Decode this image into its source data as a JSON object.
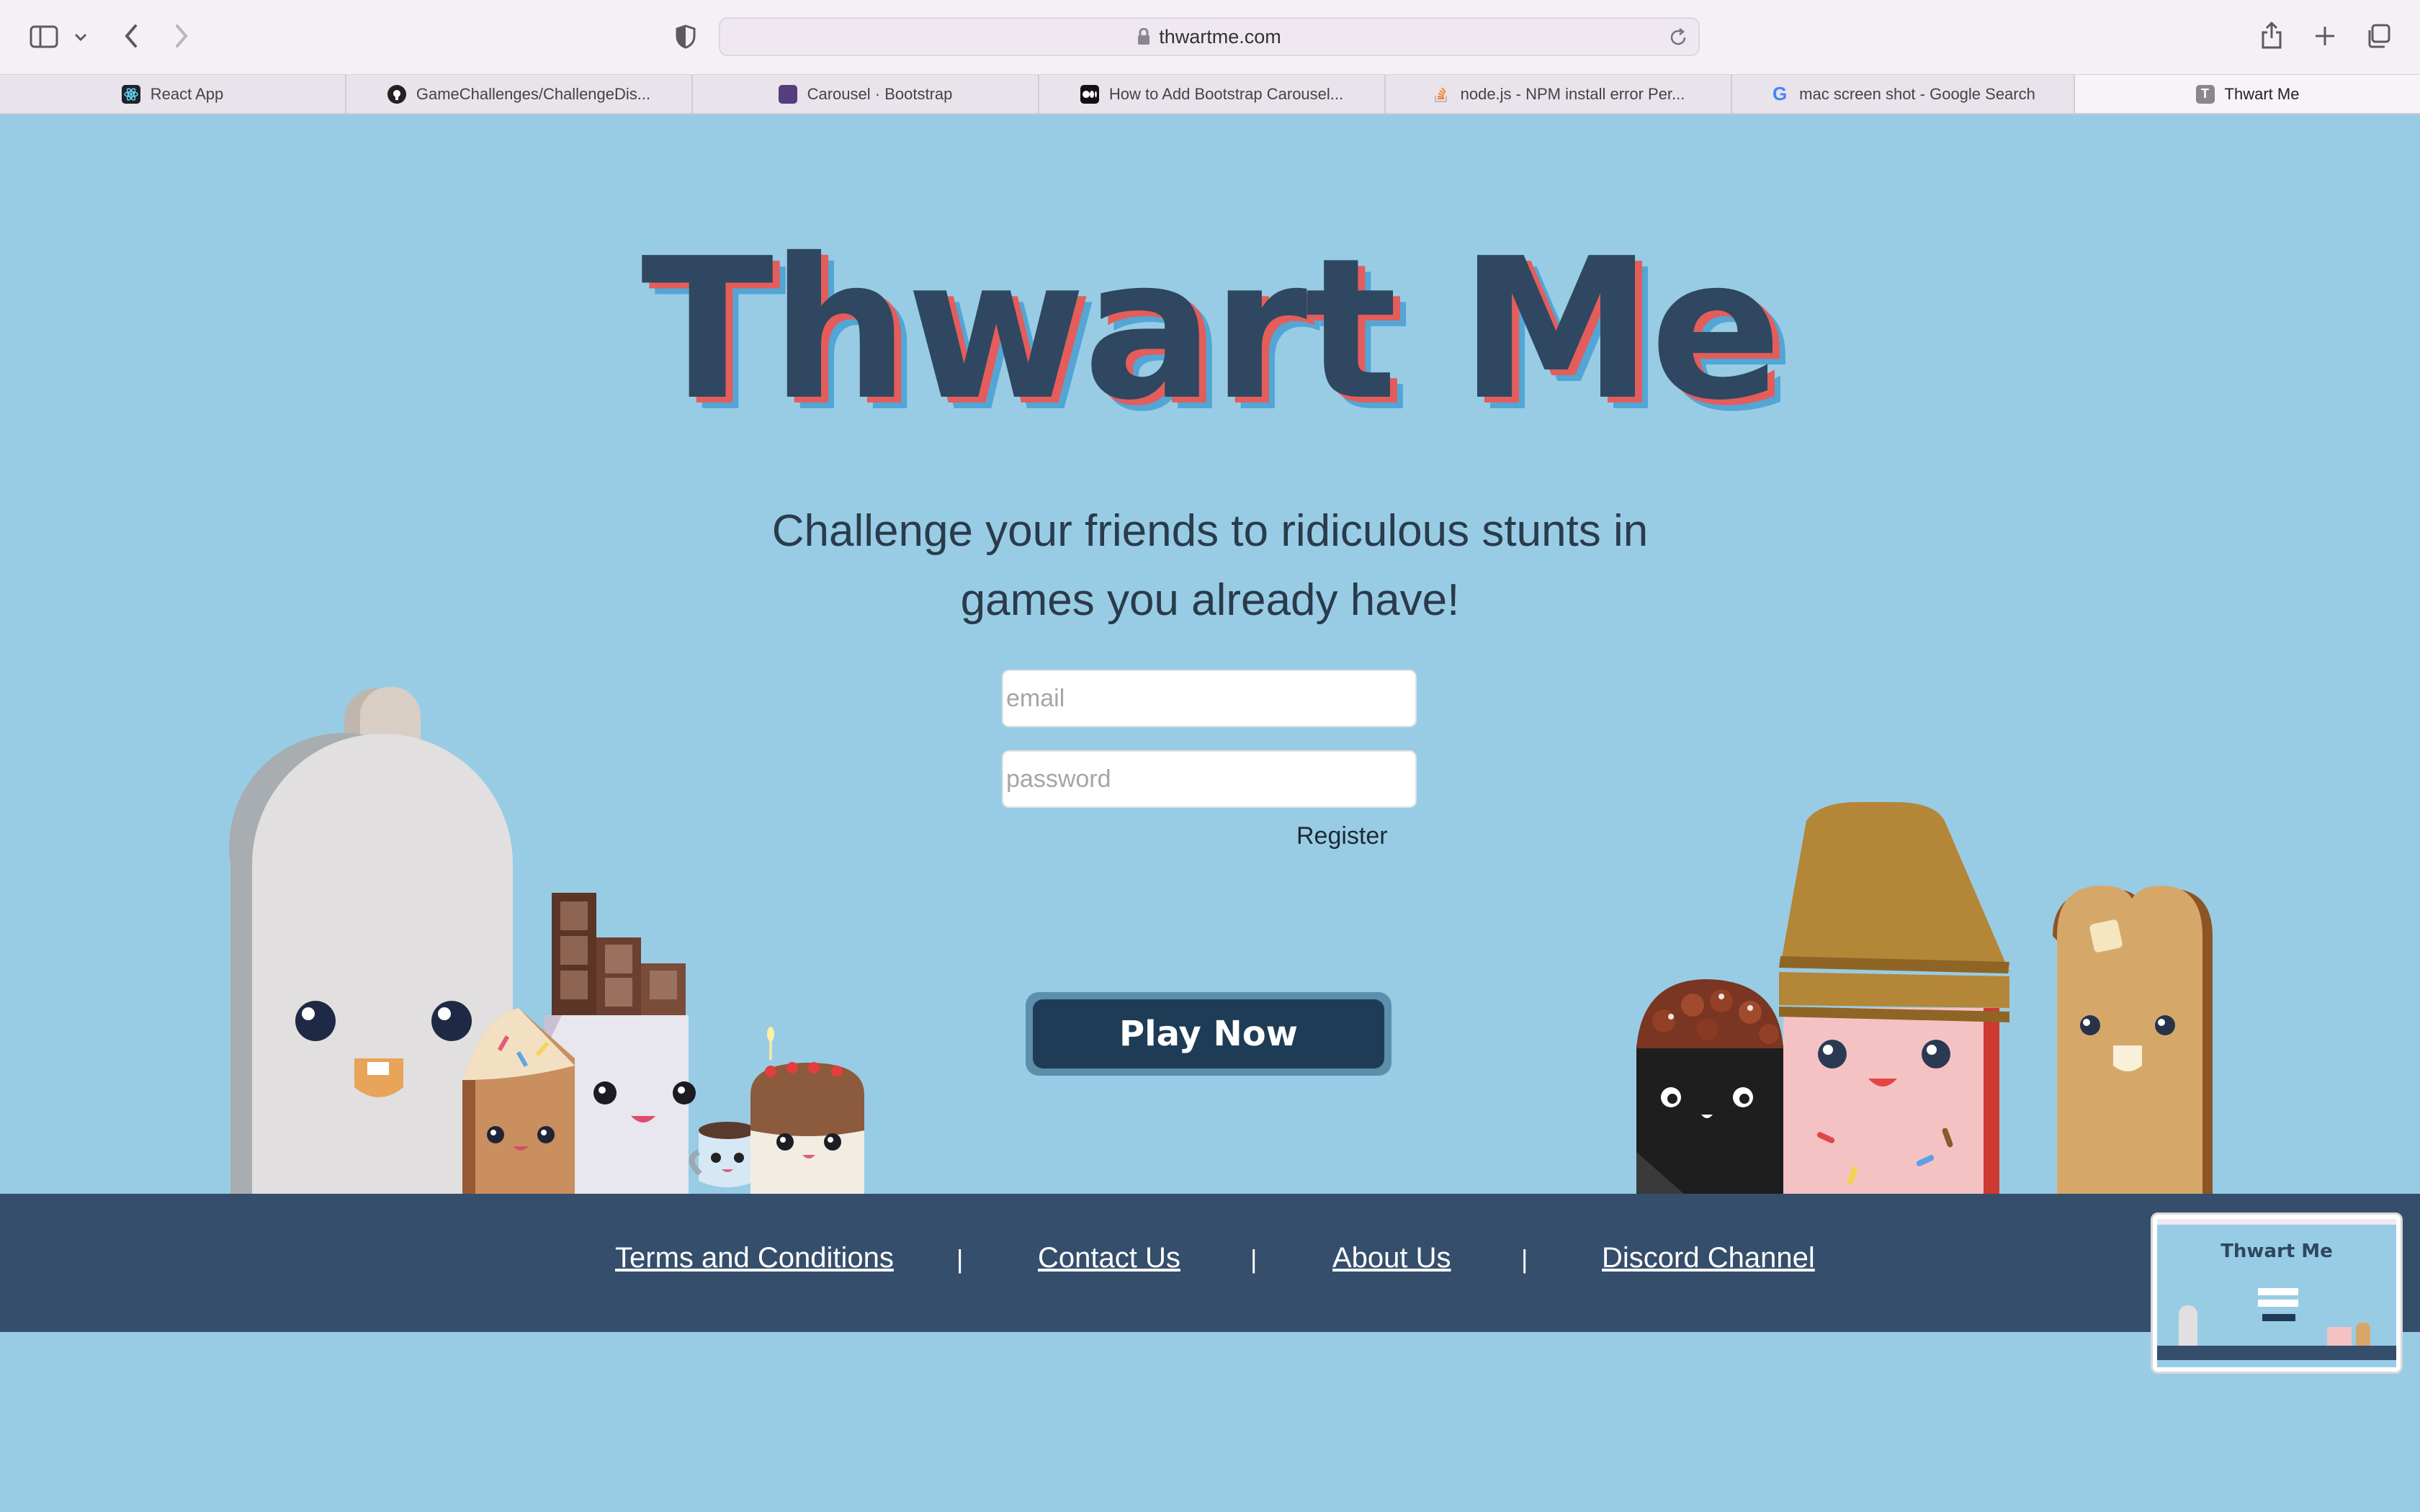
{
  "browser": {
    "url": "thwartme.com",
    "tabs": [
      {
        "label": "React App",
        "icon": "react-icon",
        "active": false
      },
      {
        "label": "GameChallenges/ChallengeDis...",
        "icon": "github-icon",
        "active": false
      },
      {
        "label": "Carousel · Bootstrap",
        "icon": "bootstrap-icon",
        "active": false
      },
      {
        "label": "How to Add Bootstrap Carousel...",
        "icon": "medium-icon",
        "active": false
      },
      {
        "label": "node.js - NPM install error Per...",
        "icon": "stackoverflow-icon",
        "active": false
      },
      {
        "label": "mac screen shot - Google Search",
        "icon": "google-icon",
        "active": false
      },
      {
        "label": "Thwart Me",
        "icon": "t-icon",
        "active": true
      }
    ]
  },
  "hero": {
    "title": "Thwart Me",
    "tagline_line1": "Challenge your friends to ridiculous stunts in",
    "tagline_line2": "games you already have!"
  },
  "form": {
    "email_placeholder": "email",
    "password_placeholder": "password",
    "register_label": "Register",
    "play_label": "Play Now"
  },
  "footer": {
    "links": [
      "Terms and Conditions",
      "Contact Us",
      "About Us",
      "Discord Channel"
    ],
    "separator": "|"
  },
  "thumbnail": {
    "title": "Thwart Me"
  },
  "colors": {
    "page_bg": "#98cce5",
    "title": "#2f4760",
    "title_shadow_red": "#e35d5b",
    "title_shadow_blue": "#52a6d6",
    "button": "#1f3c56",
    "footer": "#354e6c"
  }
}
